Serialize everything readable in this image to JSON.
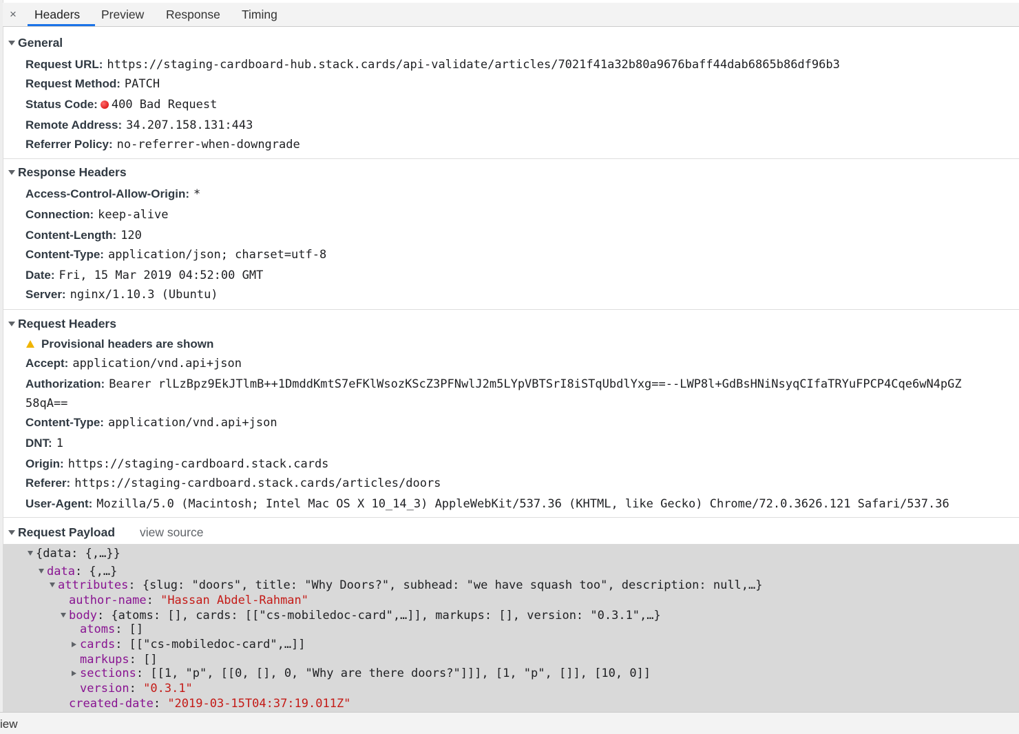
{
  "tabs": {
    "close": "×",
    "headers": "Headers",
    "preview": "Preview",
    "response": "Response",
    "timing": "Timing"
  },
  "general": {
    "title": "General",
    "rows": [
      {
        "key": "Request URL:",
        "value": "https://staging-cardboard-hub.stack.cards/api-validate/articles/7021f41a32b80a9676baff44dab6865b86df96b3"
      },
      {
        "key": "Request Method:",
        "value": "PATCH"
      },
      {
        "key": "Status Code:",
        "value": "400 Bad Request",
        "status_color": "#d40000"
      },
      {
        "key": "Remote Address:",
        "value": "34.207.158.131:443"
      },
      {
        "key": "Referrer Policy:",
        "value": "no-referrer-when-downgrade"
      }
    ]
  },
  "response_headers": {
    "title": "Response Headers",
    "rows": [
      {
        "key": "Access-Control-Allow-Origin:",
        "value": "*"
      },
      {
        "key": "Connection:",
        "value": "keep-alive"
      },
      {
        "key": "Content-Length:",
        "value": "120"
      },
      {
        "key": "Content-Type:",
        "value": "application/json; charset=utf-8"
      },
      {
        "key": "Date:",
        "value": "Fri, 15 Mar 2019 04:52:00 GMT"
      },
      {
        "key": "Server:",
        "value": "nginx/1.10.3 (Ubuntu)"
      }
    ]
  },
  "request_headers": {
    "title": "Request Headers",
    "warning": "Provisional headers are shown",
    "rows": [
      {
        "key": "Accept:",
        "value": "application/vnd.api+json"
      },
      {
        "key": "Authorization:",
        "value": "Bearer rlLzBpz9EkJTlmB++1DmddKmtS7eFKlWsozKScZ3PFNwlJ2m5LYpVBTSrI8iSTqUbdlYxg==--LWP8l+GdBsHNiNsyqCIfaTRYuFPCP4Cqe6wN4pGZ",
        "continuation": "58qA=="
      },
      {
        "key": "Content-Type:",
        "value": "application/vnd.api+json"
      },
      {
        "key": "DNT:",
        "value": "1"
      },
      {
        "key": "Origin:",
        "value": "https://staging-cardboard.stack.cards"
      },
      {
        "key": "Referer:",
        "value": "https://staging-cardboard.stack.cards/articles/doors"
      },
      {
        "key": "User-Agent:",
        "value": "Mozilla/5.0 (Macintosh; Intel Mac OS X 10_14_3) AppleWebKit/537.36 (KHTML, like Gecko) Chrome/72.0.3626.121 Safari/537.36"
      }
    ]
  },
  "payload": {
    "title": "Request Payload",
    "view_source": "view source",
    "root": "{data: {,…}}",
    "data_key": "data",
    "data_val": ": {,…}",
    "attributes_key": "attributes",
    "attributes_val": ": {slug: \"doors\", title: \"Why Doors?\", subhead: \"we have squash too\", description: null,…}",
    "author_key": "author-name",
    "author_val": "\"Hassan Abdel-Rahman\"",
    "body_key": "body",
    "body_val": ": {atoms: [], cards: [[\"cs-mobiledoc-card\",…]], markups: [], version: \"0.3.1\",…}",
    "atoms_key": "atoms",
    "atoms_val": ": []",
    "cards_key": "cards",
    "cards_val": ": [[\"cs-mobiledoc-card\",…]]",
    "markups_key": "markups",
    "markups_val": ": []",
    "sections_key": "sections",
    "sections_val": ": [[1, \"p\", [[0, [], 0, \"Why are there doors?\"]]], [1, \"p\", []], [10, 0]]",
    "version_key": "version",
    "version_val": "\"0.3.1\"",
    "created_key": "created-date",
    "created_val": "\"2019-03-15T04:37:19.011Z\""
  },
  "bottom": {
    "label": "iew"
  }
}
